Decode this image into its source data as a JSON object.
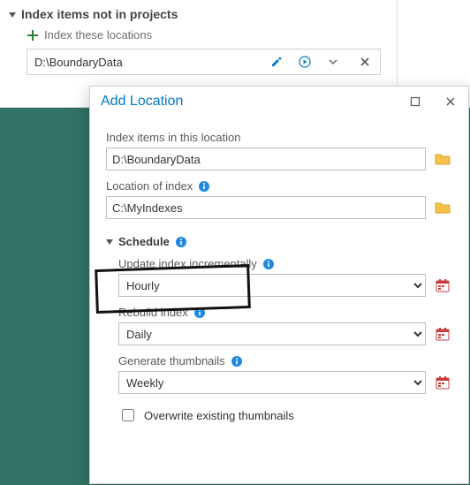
{
  "colors": {
    "accent": "#0079c1",
    "addGreen": "#2e7d32",
    "iconBlue": "#1e88e5"
  },
  "topPanel": {
    "title": "Index items not in projects",
    "addLabel": "Index these locations",
    "entryPath": "D:\\BoundaryData"
  },
  "dialog": {
    "title": "Add Location",
    "fields": {
      "itemsLabel": "Index items in this location",
      "itemsValue": "D:\\BoundaryData",
      "indexLabel": "Location of index",
      "indexValue": "C:\\MyIndexes"
    },
    "schedule": {
      "header": "Schedule",
      "update": {
        "label": "Update index incrementally",
        "value": "Hourly"
      },
      "rebuild": {
        "label": "Rebuild index",
        "value": "Daily"
      },
      "thumbs": {
        "label": "Generate thumbnails",
        "value": "Weekly"
      },
      "overwriteLabel": "Overwrite existing thumbnails",
      "overwriteChecked": false
    }
  }
}
